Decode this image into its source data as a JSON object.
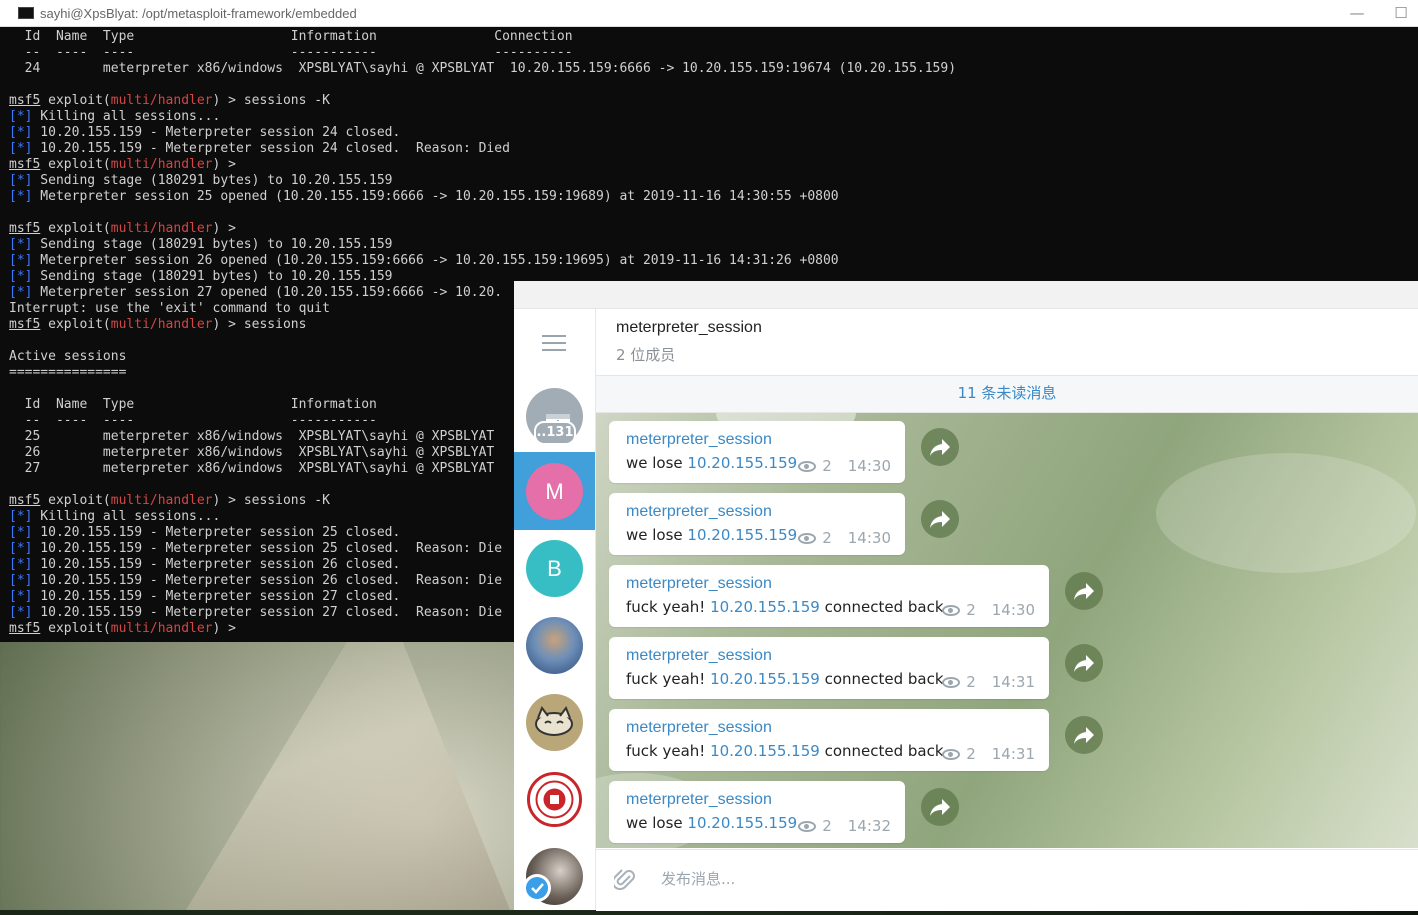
{
  "terminal": {
    "title": "sayhi@XpsBlyat: /opt/metasploit-framework/embedded",
    "lines": [
      [
        {
          "t": "  Id  Name  Type                    Information               Connection"
        }
      ],
      [
        {
          "t": "  --  ----  ----                    -----------               ----------"
        }
      ],
      [
        {
          "t": "  24        meterpreter x86/windows  XPSBLYAT\\sayhi @ XPSBLYAT  10.20.155.159:6666 -> 10.20.155.159:19674 (10.20.155.159)"
        }
      ],
      [
        {
          "t": ""
        }
      ],
      [
        {
          "t": "msf5",
          "c": "u"
        },
        {
          "t": " exploit("
        },
        {
          "t": "multi/handler",
          "c": "red"
        },
        {
          "t": ") > sessions -K"
        }
      ],
      [
        {
          "t": "[*]",
          "c": "blue"
        },
        {
          "t": " Killing all sessions..."
        }
      ],
      [
        {
          "t": "[*]",
          "c": "blue"
        },
        {
          "t": " 10.20.155.159 - Meterpreter session 24 closed."
        }
      ],
      [
        {
          "t": "[*]",
          "c": "blue"
        },
        {
          "t": " 10.20.155.159 - Meterpreter session 24 closed.  Reason: Died"
        }
      ],
      [
        {
          "t": "msf5",
          "c": "u"
        },
        {
          "t": " exploit("
        },
        {
          "t": "multi/handler",
          "c": "red"
        },
        {
          "t": ") >"
        }
      ],
      [
        {
          "t": "[*]",
          "c": "blue"
        },
        {
          "t": " Sending stage (180291 bytes) to 10.20.155.159"
        }
      ],
      [
        {
          "t": "[*]",
          "c": "blue"
        },
        {
          "t": " Meterpreter session 25 opened (10.20.155.159:6666 -> 10.20.155.159:19689) at 2019-11-16 14:30:55 +0800"
        }
      ],
      [
        {
          "t": ""
        }
      ],
      [
        {
          "t": "msf5",
          "c": "u"
        },
        {
          "t": " exploit("
        },
        {
          "t": "multi/handler",
          "c": "red"
        },
        {
          "t": ") >"
        }
      ],
      [
        {
          "t": "[*]",
          "c": "blue"
        },
        {
          "t": " Sending stage (180291 bytes) to 10.20.155.159"
        }
      ],
      [
        {
          "t": "[*]",
          "c": "blue"
        },
        {
          "t": " Meterpreter session 26 opened (10.20.155.159:6666 -> 10.20.155.159:19695) at 2019-11-16 14:31:26 +0800"
        }
      ],
      [
        {
          "t": "[*]",
          "c": "blue"
        },
        {
          "t": " Sending stage (180291 bytes) to 10.20.155.159"
        }
      ],
      [
        {
          "t": "[*]",
          "c": "blue"
        },
        {
          "t": " Meterpreter session 27 opened (10.20.155.159:6666 -> 10.20."
        }
      ],
      [
        {
          "t": "Interrupt: use the 'exit' command to quit"
        }
      ],
      [
        {
          "t": "msf5",
          "c": "u"
        },
        {
          "t": " exploit("
        },
        {
          "t": "multi/handler",
          "c": "red"
        },
        {
          "t": ") > sessions"
        }
      ],
      [
        {
          "t": ""
        }
      ],
      [
        {
          "t": "Active sessions"
        }
      ],
      [
        {
          "t": "==============="
        }
      ],
      [
        {
          "t": ""
        }
      ],
      [
        {
          "t": "  Id  Name  Type                    Information"
        }
      ],
      [
        {
          "t": "  --  ----  ----                    -----------"
        }
      ],
      [
        {
          "t": "  25        meterpreter x86/windows  XPSBLYAT\\sayhi @ XPSBLYAT"
        }
      ],
      [
        {
          "t": "  26        meterpreter x86/windows  XPSBLYAT\\sayhi @ XPSBLYAT"
        }
      ],
      [
        {
          "t": "  27        meterpreter x86/windows  XPSBLYAT\\sayhi @ XPSBLYAT"
        }
      ],
      [
        {
          "t": ""
        }
      ],
      [
        {
          "t": "msf5",
          "c": "u"
        },
        {
          "t": " exploit("
        },
        {
          "t": "multi/handler",
          "c": "red"
        },
        {
          "t": ") > sessions -K"
        }
      ],
      [
        {
          "t": "[*]",
          "c": "blue"
        },
        {
          "t": " Killing all sessions..."
        }
      ],
      [
        {
          "t": "[*]",
          "c": "blue"
        },
        {
          "t": " 10.20.155.159 - Meterpreter session 25 closed."
        }
      ],
      [
        {
          "t": "[*]",
          "c": "blue"
        },
        {
          "t": " 10.20.155.159 - Meterpreter session 25 closed.  Reason: Die"
        }
      ],
      [
        {
          "t": "[*]",
          "c": "blue"
        },
        {
          "t": " 10.20.155.159 - Meterpreter session 26 closed."
        }
      ],
      [
        {
          "t": "[*]",
          "c": "blue"
        },
        {
          "t": " 10.20.155.159 - Meterpreter session 26 closed.  Reason: Die"
        }
      ],
      [
        {
          "t": "[*]",
          "c": "blue"
        },
        {
          "t": " 10.20.155.159 - Meterpreter session 27 closed."
        }
      ],
      [
        {
          "t": "[*]",
          "c": "blue"
        },
        {
          "t": " 10.20.155.159 - Meterpreter session 27 closed.  Reason: Die"
        }
      ],
      [
        {
          "t": "msf5",
          "c": "u"
        },
        {
          "t": " exploit("
        },
        {
          "t": "multi/handler",
          "c": "red"
        },
        {
          "t": ") > "
        }
      ]
    ]
  },
  "telegram": {
    "chat_name": "meterpreter_session",
    "members": "2 位成员",
    "unread_count": "11",
    "unread_text": " 条未读消息",
    "archive_badge": "..131",
    "avatar_m": "M",
    "avatar_b": "B",
    "input_placeholder": "发布消息...",
    "messages": [
      {
        "sender": "meterpreter_session",
        "prefix": "we lose ",
        "ip": "10.20.155.159",
        "suffix": "",
        "views": "2",
        "time": "14:30"
      },
      {
        "sender": "meterpreter_session",
        "prefix": "we lose ",
        "ip": "10.20.155.159",
        "suffix": "",
        "views": "2",
        "time": "14:30"
      },
      {
        "sender": "meterpreter_session",
        "prefix": "fuck yeah! ",
        "ip": "10.20.155.159",
        "suffix": " connected back",
        "views": "2",
        "time": "14:30"
      },
      {
        "sender": "meterpreter_session",
        "prefix": "fuck yeah! ",
        "ip": "10.20.155.159",
        "suffix": " connected back",
        "views": "2",
        "time": "14:31"
      },
      {
        "sender": "meterpreter_session",
        "prefix": "fuck yeah! ",
        "ip": "10.20.155.159",
        "suffix": " connected back",
        "views": "2",
        "time": "14:31"
      },
      {
        "sender": "meterpreter_session",
        "prefix": "we lose ",
        "ip": "10.20.155.159",
        "suffix": "",
        "views": "2",
        "time": "14:32"
      }
    ]
  },
  "colors": {
    "accent": "#419fd9",
    "link": "#3a88c5",
    "prompt_red": "#d54545",
    "marker_blue": "#3b78ff"
  }
}
